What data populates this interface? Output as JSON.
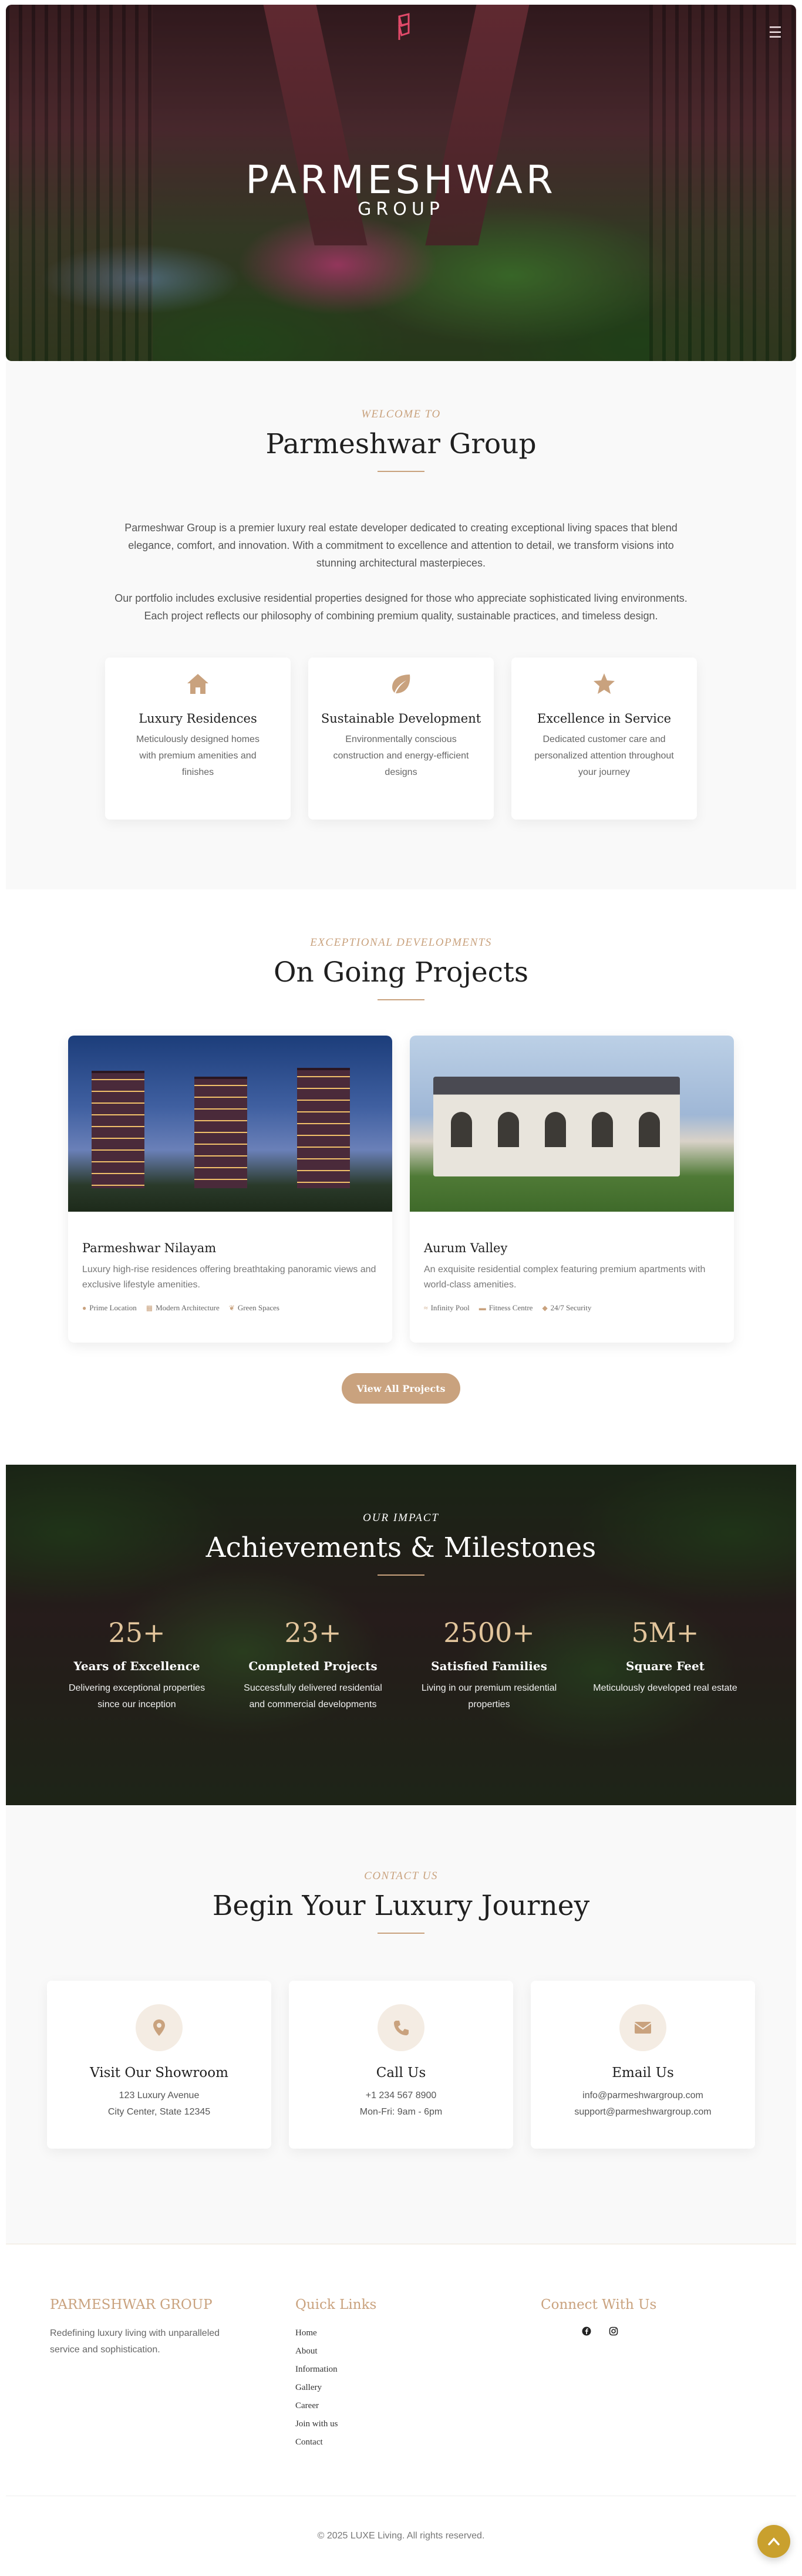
{
  "hero": {
    "brand_main": "PARMESHWAR",
    "brand_sub": "GROUP",
    "menu_icon": "hamburger-icon",
    "logo_icon": "pg-logo-mark"
  },
  "welcome": {
    "kicker": "WELCOME TO",
    "title": "Parmeshwar Group",
    "paragraph_1": "Parmeshwar Group is a premier luxury real estate developer dedicated to creating exceptional living spaces that blend elegance, comfort, and innovation. With a commitment to excellence and attention to detail, we transform visions into stunning architectural masterpieces.",
    "paragraph_2": "Our portfolio includes exclusive residential properties designed for those who appreciate sophisticated living environments. Each project reflects our philosophy of combining premium quality, sustainable practices, and timeless design.",
    "features": [
      {
        "icon": "home-icon",
        "title": "Luxury Residences",
        "text": "Meticulously designed homes with premium amenities and finishes"
      },
      {
        "icon": "leaf-icon",
        "title": "Sustainable Development",
        "text": "Environmentally conscious construction and energy-efficient designs"
      },
      {
        "icon": "star-icon",
        "title": "Excellence in Service",
        "text": "Dedicated customer care and personalized attention throughout your journey"
      }
    ]
  },
  "projects": {
    "kicker": "EXCEPTIONAL DEVELOPMENTS",
    "title": "On Going Projects",
    "items": [
      {
        "title": "Parmeshwar Nilayam",
        "desc": "Luxury high-rise residences offering breathtaking panoramic views and exclusive lifestyle amenities.",
        "tags": [
          "Prime Location",
          "Modern Architecture",
          "Green Spaces"
        ]
      },
      {
        "title": "Aurum Valley",
        "desc": "An exquisite residential complex featuring premium apartments with world-class amenities.",
        "tags": [
          "Infinity Pool",
          "Fitness Centre",
          "24/7 Security"
        ]
      }
    ],
    "button_label": "View All Projects"
  },
  "impact": {
    "kicker": "OUR IMPACT",
    "title": "Achievements & Milestones",
    "stats": [
      {
        "num": "25+",
        "label": "Years of Excellence",
        "desc": "Delivering exceptional properties since our inception"
      },
      {
        "num": "23+",
        "label": "Completed Projects",
        "desc": "Successfully delivered residential and commercial developments"
      },
      {
        "num": "2500+",
        "label": "Satisfied Families",
        "desc": "Living in our premium residential properties"
      },
      {
        "num": "5M+",
        "label": "Square Feet",
        "desc": "Meticulously developed real estate"
      }
    ]
  },
  "contact": {
    "kicker": "CONTACT US",
    "title": "Begin Your Luxury Journey",
    "cards": [
      {
        "icon": "map-pin-icon",
        "title": "Visit Our Showroom",
        "line1": "123 Luxury Avenue",
        "line2": "City Center, State 12345"
      },
      {
        "icon": "phone-icon",
        "title": "Call Us",
        "line1": "+1 234 567 8900",
        "line2": "Mon-Fri: 9am - 6pm"
      },
      {
        "icon": "envelope-icon",
        "title": "Email Us",
        "line1": "info@parmeshwargroup.com",
        "line2": "support@parmeshwargroup.com"
      }
    ]
  },
  "footer": {
    "brand": "PARMESHWAR GROUP",
    "tagline": "Redefining luxury living with unparalleled service and sophistication.",
    "links_heading": "Quick Links",
    "links": [
      "Home",
      "About",
      "Information",
      "Gallery",
      "Career",
      "Join with us",
      "Contact"
    ],
    "connect_heading": "Connect With Us",
    "copyright": "© 2025 LUXE Living. All rights reserved."
  },
  "colors": {
    "accent": "#c9a27e",
    "stat_number": "#e2c59c",
    "back_to_top": "#c9a02e"
  }
}
